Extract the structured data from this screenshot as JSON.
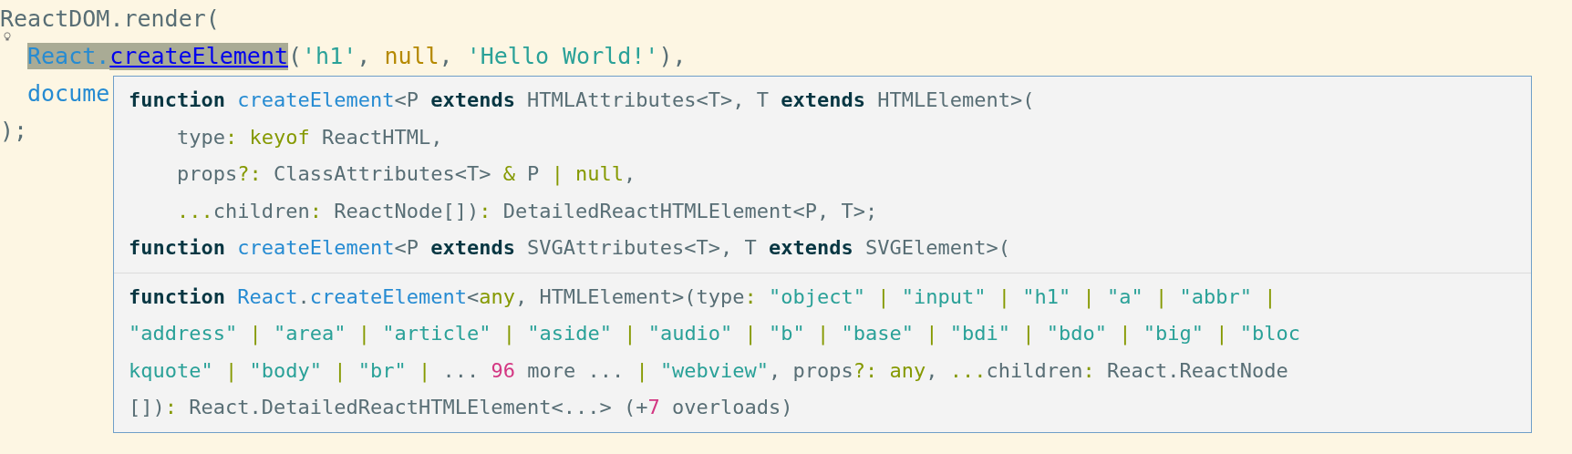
{
  "editor": {
    "lines": [
      [
        {
          "text": "ReactDOM.render(",
          "kind": "plain"
        }
      ],
      [
        {
          "text": "React.",
          "kind": "func",
          "highlighted": true
        },
        {
          "text": "createElement",
          "kind": "link",
          "highlighted": true
        },
        {
          "text": "(",
          "kind": "plain"
        },
        {
          "text": "'h1'",
          "kind": "string"
        },
        {
          "text": ", ",
          "kind": "plain"
        },
        {
          "text": "null",
          "kind": "constant"
        },
        {
          "text": ", ",
          "kind": "plain"
        },
        {
          "text": "'Hello World!'",
          "kind": "string"
        },
        {
          "text": "),",
          "kind": "plain"
        }
      ],
      [
        {
          "text": "docume",
          "kind": "func"
        }
      ],
      [
        {
          "text": ");",
          "kind": "plain"
        }
      ]
    ]
  },
  "tooltip": {
    "signature": [
      [
        {
          "text": "function ",
          "kind": "keyword"
        },
        {
          "text": "createElement",
          "kind": "name"
        },
        {
          "text": "<P ",
          "kind": "plain"
        },
        {
          "text": "extends",
          "kind": "keyword"
        },
        {
          "text": " HTMLAttributes<T>, T ",
          "kind": "plain"
        },
        {
          "text": "extends",
          "kind": "keyword"
        },
        {
          "text": " HTMLElement>(",
          "kind": "plain"
        }
      ],
      [
        {
          "text": "    type",
          "kind": "plain"
        },
        {
          "text": ": keyof",
          "kind": "operator"
        },
        {
          "text": " ReactHTML,",
          "kind": "plain"
        }
      ],
      [
        {
          "text": "    props",
          "kind": "plain"
        },
        {
          "text": "?:",
          "kind": "operator"
        },
        {
          "text": " ClassAttributes<T> ",
          "kind": "plain"
        },
        {
          "text": "&",
          "kind": "operator"
        },
        {
          "text": " P ",
          "kind": "plain"
        },
        {
          "text": "| null",
          "kind": "operator"
        },
        {
          "text": ",",
          "kind": "plain"
        }
      ],
      [
        {
          "text": "    ...",
          "kind": "operator"
        },
        {
          "text": "children",
          "kind": "plain"
        },
        {
          "text": ":",
          "kind": "operator"
        },
        {
          "text": " ReactNode[]",
          "kind": "plain"
        },
        {
          "text": ")",
          "kind": "plain"
        },
        {
          "text": ":",
          "kind": "operator"
        },
        {
          "text": " DetailedReactHTMLElement<P, T>;",
          "kind": "plain"
        }
      ],
      [
        {
          "text": "function ",
          "kind": "keyword"
        },
        {
          "text": "createElement",
          "kind": "name"
        },
        {
          "text": "<P ",
          "kind": "plain"
        },
        {
          "text": "extends",
          "kind": "keyword"
        },
        {
          "text": " SVGAttributes<T>, T ",
          "kind": "plain"
        },
        {
          "text": "extends",
          "kind": "keyword"
        },
        {
          "text": " SVGElement>(",
          "kind": "plain"
        }
      ]
    ],
    "details": [
      [
        {
          "text": "function ",
          "kind": "keyword"
        },
        {
          "text": "React",
          "kind": "name"
        },
        {
          "text": ".",
          "kind": "plain"
        },
        {
          "text": "createElement",
          "kind": "name"
        },
        {
          "text": "<",
          "kind": "plain"
        },
        {
          "text": "any",
          "kind": "operator"
        },
        {
          "text": ", HTMLElement>(type",
          "kind": "plain"
        },
        {
          "text": ": ",
          "kind": "operator"
        },
        {
          "text": "\"object\"",
          "kind": "string"
        },
        {
          "text": " | ",
          "kind": "operator"
        },
        {
          "text": "\"input\"",
          "kind": "string"
        },
        {
          "text": " | ",
          "kind": "operator"
        },
        {
          "text": "\"h1\"",
          "kind": "string"
        },
        {
          "text": " | ",
          "kind": "operator"
        },
        {
          "text": "\"a\"",
          "kind": "string"
        },
        {
          "text": " | ",
          "kind": "operator"
        },
        {
          "text": "\"abbr\"",
          "kind": "string"
        },
        {
          "text": " |",
          "kind": "operator"
        }
      ],
      [
        {
          "text": "\"address\"",
          "kind": "string"
        },
        {
          "text": " | ",
          "kind": "operator"
        },
        {
          "text": "\"area\"",
          "kind": "string"
        },
        {
          "text": " | ",
          "kind": "operator"
        },
        {
          "text": "\"article\"",
          "kind": "string"
        },
        {
          "text": " | ",
          "kind": "operator"
        },
        {
          "text": "\"aside\"",
          "kind": "string"
        },
        {
          "text": " | ",
          "kind": "operator"
        },
        {
          "text": "\"audio\"",
          "kind": "string"
        },
        {
          "text": " | ",
          "kind": "operator"
        },
        {
          "text": "\"b\"",
          "kind": "string"
        },
        {
          "text": " | ",
          "kind": "operator"
        },
        {
          "text": "\"base\"",
          "kind": "string"
        },
        {
          "text": " | ",
          "kind": "operator"
        },
        {
          "text": "\"bdi\"",
          "kind": "string"
        },
        {
          "text": " | ",
          "kind": "operator"
        },
        {
          "text": "\"bdo\"",
          "kind": "string"
        },
        {
          "text": " | ",
          "kind": "operator"
        },
        {
          "text": "\"big\"",
          "kind": "string"
        },
        {
          "text": " | ",
          "kind": "operator"
        },
        {
          "text": "\"bloc",
          "kind": "string"
        }
      ],
      [
        {
          "text": "kquote\"",
          "kind": "string"
        },
        {
          "text": " | ",
          "kind": "operator"
        },
        {
          "text": "\"body\"",
          "kind": "string"
        },
        {
          "text": " | ",
          "kind": "operator"
        },
        {
          "text": "\"br\"",
          "kind": "string"
        },
        {
          "text": " | ",
          "kind": "operator"
        },
        {
          "text": "... ",
          "kind": "plain"
        },
        {
          "text": "96",
          "kind": "number"
        },
        {
          "text": " more ... ",
          "kind": "plain"
        },
        {
          "text": "| ",
          "kind": "operator"
        },
        {
          "text": "\"webview\"",
          "kind": "string"
        },
        {
          "text": ", props",
          "kind": "plain"
        },
        {
          "text": "?: any",
          "kind": "operator"
        },
        {
          "text": ", ",
          "kind": "plain"
        },
        {
          "text": "...",
          "kind": "operator"
        },
        {
          "text": "children",
          "kind": "plain"
        },
        {
          "text": ":",
          "kind": "operator"
        },
        {
          "text": " React.ReactNode",
          "kind": "plain"
        }
      ],
      [
        {
          "text": "[])",
          "kind": "plain"
        },
        {
          "text": ":",
          "kind": "operator"
        },
        {
          "text": " React.DetailedReactHTMLElement<...> (+",
          "kind": "plain"
        },
        {
          "text": "7",
          "kind": "number"
        },
        {
          "text": " overloads)",
          "kind": "plain"
        }
      ]
    ]
  }
}
